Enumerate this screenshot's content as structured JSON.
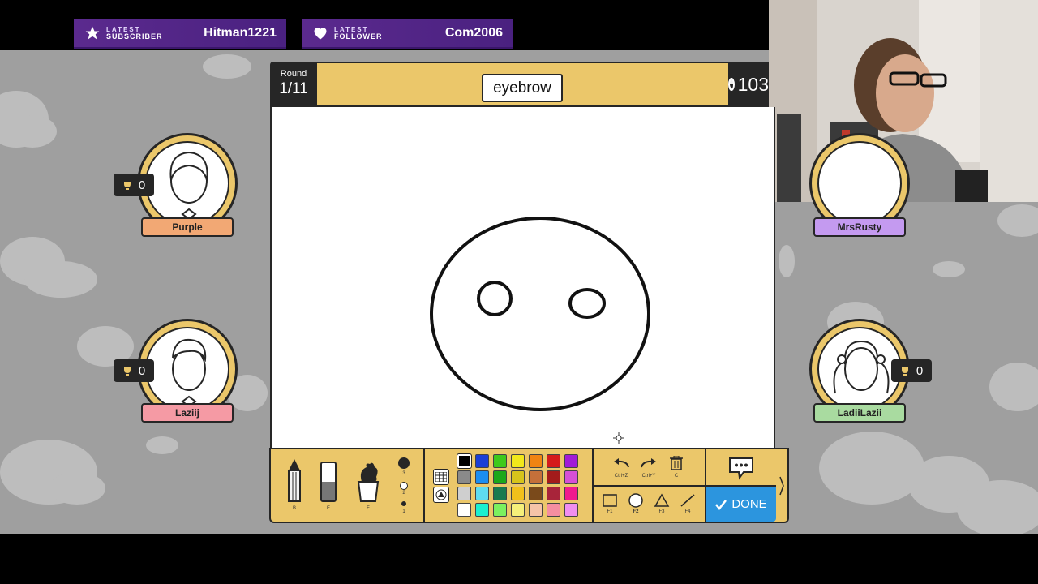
{
  "stream_overlay": {
    "latest_subscriber": {
      "tag_line1": "LATEST",
      "tag_line2": "SUBSCRIBER",
      "name": "Hitman1221",
      "icon": "star-icon"
    },
    "latest_follower": {
      "tag_line1": "LATEST",
      "tag_line2": "FOLLOWER",
      "name": "Com2006",
      "icon": "heart-icon"
    }
  },
  "game": {
    "round_label": "Round",
    "round_value": "1/11",
    "word": "eyebrow",
    "timer": "103",
    "colors": {
      "accent_yellow": "#ebc76a",
      "done_blue": "#2c95de",
      "dark": "#262626"
    }
  },
  "players": [
    {
      "name": "Purple",
      "score": "0",
      "tag_color": "#f2a874"
    },
    {
      "name": "Laziij",
      "score": "0",
      "tag_color": "#f59aa4"
    },
    {
      "name": "MrsRusty",
      "score": "0",
      "tag_color": "#c49af0"
    },
    {
      "name": "LadiiLazii",
      "score": "0",
      "tag_color": "#a9dba0"
    }
  ],
  "toolbar": {
    "tools": [
      {
        "name": "pencil-icon",
        "key": "B"
      },
      {
        "name": "eraser-icon",
        "key": "E"
      },
      {
        "name": "fill-bucket-icon",
        "key": "F"
      }
    ],
    "brush_sizes": [
      "3",
      "2",
      "1"
    ],
    "palette": [
      "#000000",
      "#1b3fd6",
      "#3ec91b",
      "#f1e81b",
      "#f08412",
      "#d41b1b",
      "#a21bd6",
      "#8a8a8a",
      "#1b8ef0",
      "#1ba81b",
      "#d6c41b",
      "#c4703a",
      "#a31b1b",
      "#d64fd6",
      "#cfcfcf",
      "#5fdcf0",
      "#1b7a4f",
      "#f0c01b",
      "#7a4a1b",
      "#a8243a",
      "#f01b8e",
      "#ffffff",
      "#1bf0d0",
      "#7af05f",
      "#f5f07a",
      "#f5c4a8",
      "#f58ea0",
      "#f08ef0"
    ],
    "undo_key": "Ctrl+Z",
    "redo_key": "Ctrl+Y",
    "clear_key": "C",
    "shape_keys": [
      "F1",
      "F2",
      "F3",
      "F4"
    ],
    "done_label": "DONE"
  }
}
